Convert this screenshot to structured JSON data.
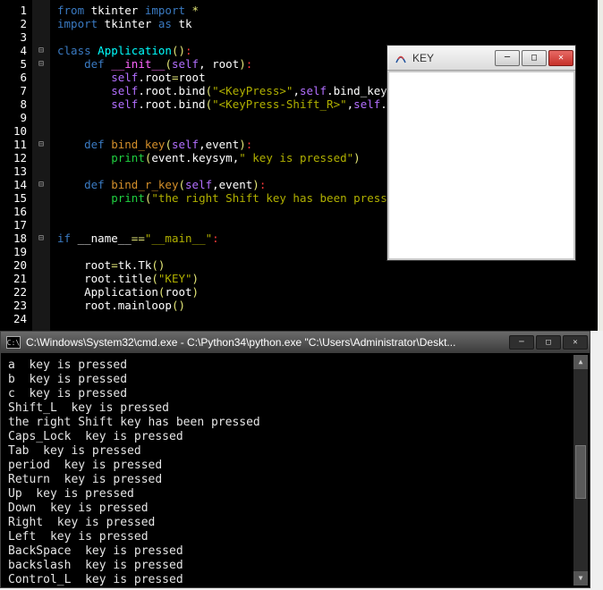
{
  "editor": {
    "line_numbers": [
      "1",
      "2",
      "3",
      "4",
      "5",
      "6",
      "7",
      "8",
      "9",
      "10",
      "11",
      "12",
      "13",
      "14",
      "15",
      "16",
      "17",
      "18",
      "19",
      "20",
      "21",
      "22",
      "23",
      "24"
    ],
    "fold_lines": [
      4,
      5,
      11,
      14,
      18
    ],
    "code": [
      [
        {
          "c": "kw",
          "t": "from"
        },
        {
          "c": "wht",
          "t": " tkinter "
        },
        {
          "c": "kw",
          "t": "import"
        },
        {
          "c": "wht",
          "t": " "
        },
        {
          "c": "yel",
          "t": "*"
        }
      ],
      [
        {
          "c": "kw",
          "t": "import"
        },
        {
          "c": "wht",
          "t": " tkinter "
        },
        {
          "c": "kw",
          "t": "as"
        },
        {
          "c": "wht",
          "t": " tk"
        }
      ],
      [],
      [
        {
          "c": "kw",
          "t": "class"
        },
        {
          "c": "wht",
          "t": " "
        },
        {
          "c": "cls",
          "t": "Application"
        },
        {
          "c": "yel",
          "t": "()"
        },
        {
          "c": "red",
          "t": ":"
        }
      ],
      [
        {
          "c": "wht",
          "t": "    "
        },
        {
          "c": "kw",
          "t": "def"
        },
        {
          "c": "wht",
          "t": " "
        },
        {
          "c": "mag",
          "t": "__init__"
        },
        {
          "c": "yel",
          "t": "("
        },
        {
          "c": "self",
          "t": "self"
        },
        {
          "c": "wht",
          "t": ", root"
        },
        {
          "c": "yel",
          "t": ")"
        },
        {
          "c": "red",
          "t": ":"
        }
      ],
      [
        {
          "c": "wht",
          "t": "        "
        },
        {
          "c": "self",
          "t": "self"
        },
        {
          "c": "wht",
          "t": ".root"
        },
        {
          "c": "yel",
          "t": "="
        },
        {
          "c": "wht",
          "t": "root"
        }
      ],
      [
        {
          "c": "wht",
          "t": "        "
        },
        {
          "c": "self",
          "t": "self"
        },
        {
          "c": "wht",
          "t": ".root.bind"
        },
        {
          "c": "yel",
          "t": "("
        },
        {
          "c": "str",
          "t": "\"<KeyPress>\""
        },
        {
          "c": "wht",
          "t": ","
        },
        {
          "c": "self",
          "t": "self"
        },
        {
          "c": "wht",
          "t": ".bind_key"
        },
        {
          "c": "yel",
          "t": ")"
        }
      ],
      [
        {
          "c": "wht",
          "t": "        "
        },
        {
          "c": "self",
          "t": "self"
        },
        {
          "c": "wht",
          "t": ".root.bind"
        },
        {
          "c": "yel",
          "t": "("
        },
        {
          "c": "str",
          "t": "\"<KeyPress-Shift_R>\""
        },
        {
          "c": "wht",
          "t": ","
        },
        {
          "c": "self",
          "t": "self"
        },
        {
          "c": "wht",
          "t": ".bind_r_key"
        },
        {
          "c": "yel",
          "t": ")"
        }
      ],
      [],
      [],
      [
        {
          "c": "wht",
          "t": "    "
        },
        {
          "c": "kw",
          "t": "def"
        },
        {
          "c": "wht",
          "t": " "
        },
        {
          "c": "fn",
          "t": "bind_key"
        },
        {
          "c": "yel",
          "t": "("
        },
        {
          "c": "self",
          "t": "self"
        },
        {
          "c": "wht",
          "t": ",event"
        },
        {
          "c": "yel",
          "t": ")"
        },
        {
          "c": "red",
          "t": ":"
        }
      ],
      [
        {
          "c": "wht",
          "t": "        "
        },
        {
          "c": "grn",
          "t": "print"
        },
        {
          "c": "yel",
          "t": "("
        },
        {
          "c": "wht",
          "t": "event.keysym,"
        },
        {
          "c": "str",
          "t": "\" key is pressed\""
        },
        {
          "c": "yel",
          "t": ")"
        }
      ],
      [],
      [
        {
          "c": "wht",
          "t": "    "
        },
        {
          "c": "kw",
          "t": "def"
        },
        {
          "c": "wht",
          "t": " "
        },
        {
          "c": "fn",
          "t": "bind_r_key"
        },
        {
          "c": "yel",
          "t": "("
        },
        {
          "c": "self",
          "t": "self"
        },
        {
          "c": "wht",
          "t": ",event"
        },
        {
          "c": "yel",
          "t": ")"
        },
        {
          "c": "red",
          "t": ":"
        }
      ],
      [
        {
          "c": "wht",
          "t": "        "
        },
        {
          "c": "grn",
          "t": "print"
        },
        {
          "c": "yel",
          "t": "("
        },
        {
          "c": "str",
          "t": "\"the right Shift key has been pressed\""
        },
        {
          "c": "yel",
          "t": ")"
        }
      ],
      [],
      [],
      [
        {
          "c": "kw",
          "t": "if"
        },
        {
          "c": "wht",
          "t": " __name__"
        },
        {
          "c": "yel",
          "t": "=="
        },
        {
          "c": "str",
          "t": "\"__main__\""
        },
        {
          "c": "red",
          "t": ":"
        }
      ],
      [],
      [
        {
          "c": "wht",
          "t": "    root"
        },
        {
          "c": "yel",
          "t": "="
        },
        {
          "c": "wht",
          "t": "tk.Tk"
        },
        {
          "c": "yel",
          "t": "()"
        }
      ],
      [
        {
          "c": "wht",
          "t": "    root.title"
        },
        {
          "c": "yel",
          "t": "("
        },
        {
          "c": "str",
          "t": "\"KEY\""
        },
        {
          "c": "yel",
          "t": ")"
        }
      ],
      [
        {
          "c": "wht",
          "t": "    Application"
        },
        {
          "c": "yel",
          "t": "("
        },
        {
          "c": "wht",
          "t": "root"
        },
        {
          "c": "yel",
          "t": ")"
        }
      ],
      [
        {
          "c": "wht",
          "t": "    root.mainloop"
        },
        {
          "c": "yel",
          "t": "()"
        }
      ],
      []
    ]
  },
  "popup": {
    "title": "KEY"
  },
  "terminal": {
    "title": "C:\\Windows\\System32\\cmd.exe - C:\\Python34\\python.exe  \"C:\\Users\\Administrator\\Deskt...",
    "lines": [
      "a  key is pressed",
      "b  key is pressed",
      "c  key is pressed",
      "Shift_L  key is pressed",
      "the right Shift key has been pressed",
      "Caps_Lock  key is pressed",
      "Tab  key is pressed",
      "period  key is pressed",
      "Return  key is pressed",
      "Up  key is pressed",
      "Down  key is pressed",
      "Right  key is pressed",
      "Left  key is pressed",
      "BackSpace  key is pressed",
      "backslash  key is pressed",
      "Control_L  key is pressed"
    ]
  }
}
